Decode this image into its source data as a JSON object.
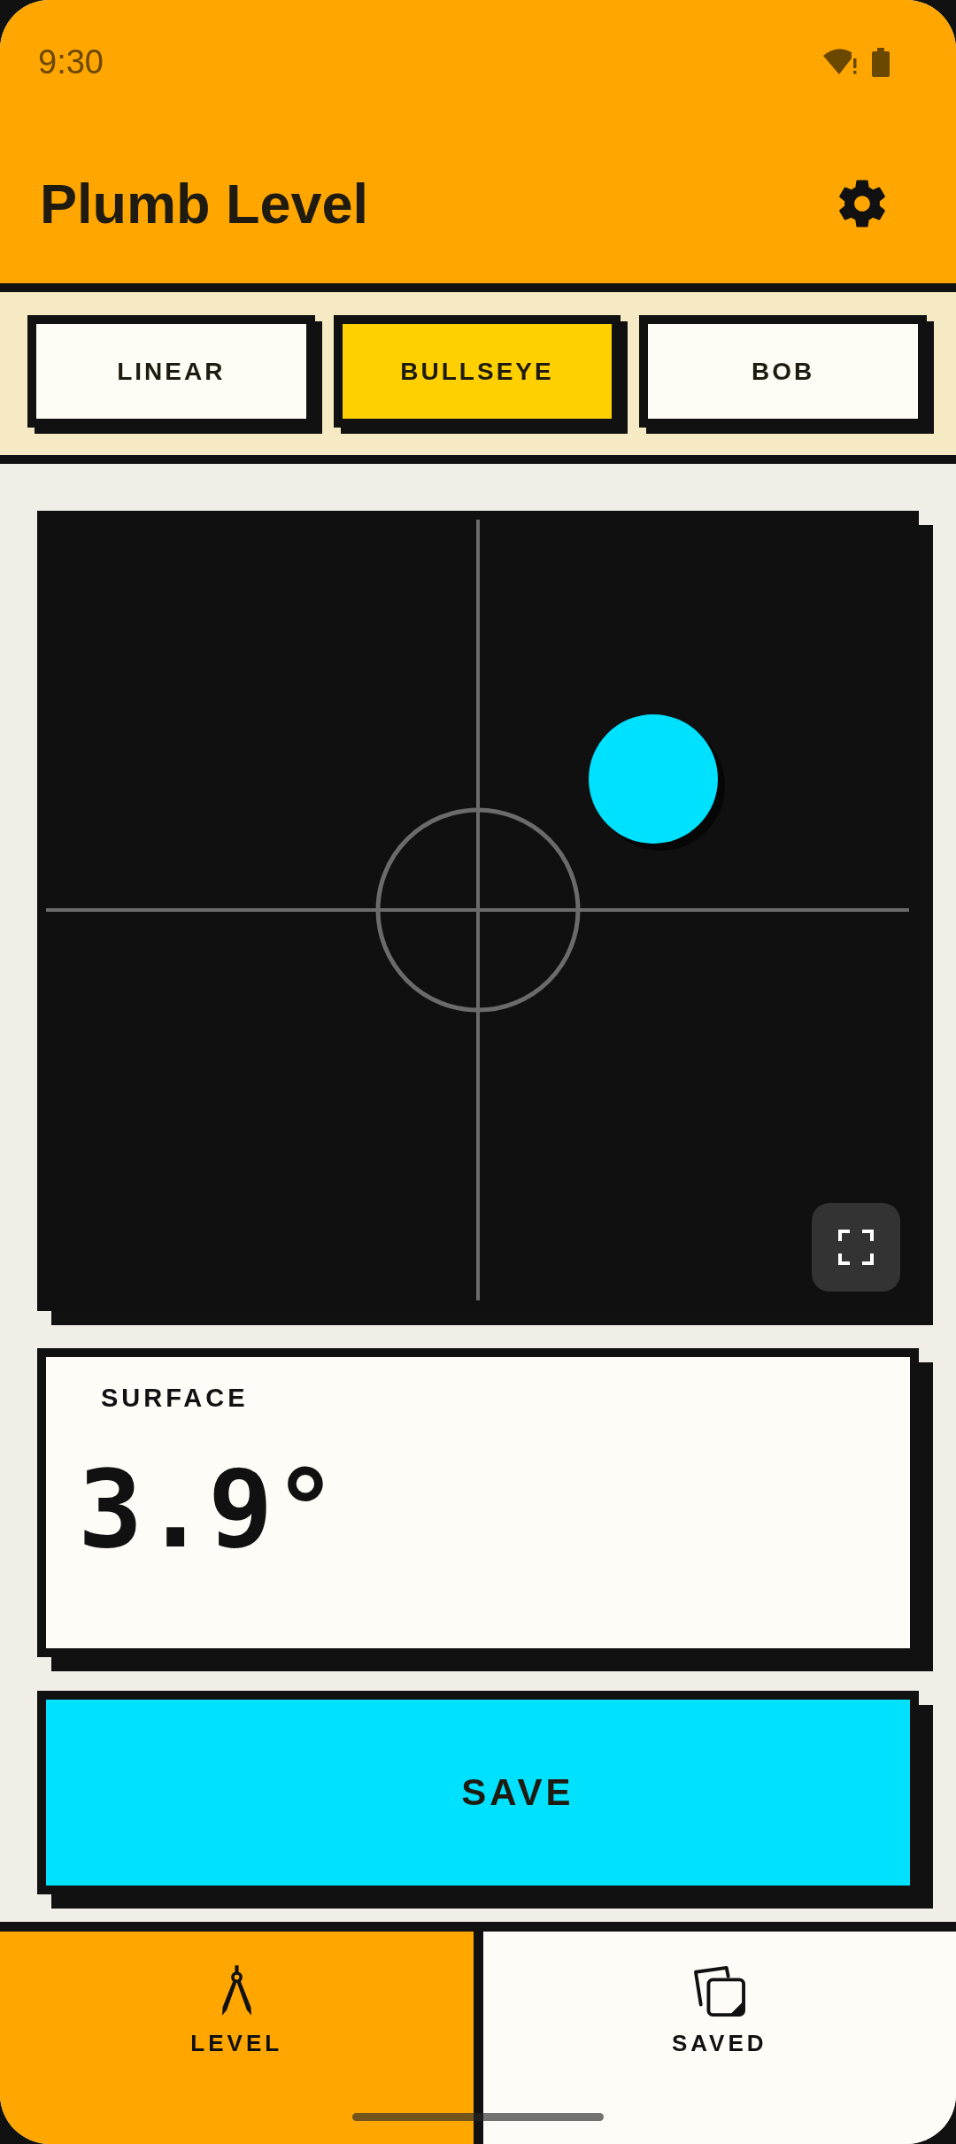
{
  "status_bar": {
    "time": "9:30"
  },
  "app_bar": {
    "title": "Plumb Level"
  },
  "mode_tabs": [
    {
      "label": "LINEAR",
      "selected": false
    },
    {
      "label": "BULLSEYE",
      "selected": true
    },
    {
      "label": "BOB",
      "selected": false
    }
  ],
  "reading": {
    "label": "SURFACE",
    "value": "3.9°"
  },
  "save_button": {
    "label": "SAVE"
  },
  "bottom_nav": [
    {
      "label": "LEVEL",
      "selected": true
    },
    {
      "label": "SAVED",
      "selected": false
    }
  ]
}
